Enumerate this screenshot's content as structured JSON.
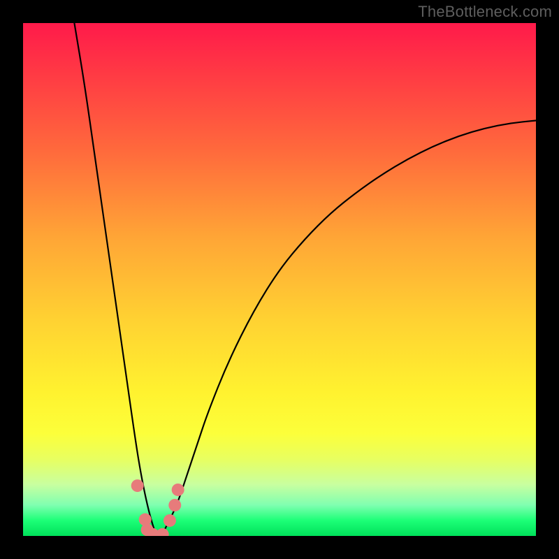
{
  "attribution": "TheBottleneck.com",
  "chart_data": {
    "type": "line",
    "title": "",
    "xlabel": "",
    "ylabel": "",
    "xlim": [
      0,
      100
    ],
    "ylim": [
      0,
      100
    ],
    "series": [
      {
        "name": "bottleneck-curve",
        "x": [
          10,
          12,
          14,
          16,
          18,
          20,
          22,
          23,
          24,
          25,
          26,
          27,
          28,
          30,
          32,
          34,
          36,
          40,
          45,
          50,
          55,
          60,
          65,
          70,
          75,
          80,
          85,
          90,
          95,
          100
        ],
        "values": [
          100,
          88,
          74,
          60,
          46,
          32,
          18,
          12,
          7,
          3,
          0,
          0,
          2,
          6,
          12,
          18,
          24,
          34,
          44,
          52,
          58,
          63,
          67,
          70.5,
          73.5,
          76,
          78,
          79.5,
          80.5,
          81
        ]
      }
    ],
    "points": [
      {
        "x": 22.3,
        "y": 9.8
      },
      {
        "x": 23.8,
        "y": 3.2
      },
      {
        "x": 24.2,
        "y": 1.2
      },
      {
        "x": 25.3,
        "y": 0.3
      },
      {
        "x": 27.2,
        "y": 0.3
      },
      {
        "x": 28.6,
        "y": 3.0
      },
      {
        "x": 29.6,
        "y": 6.0
      },
      {
        "x": 30.2,
        "y": 9.0
      }
    ],
    "point_color": "#e77b7b",
    "annotations": []
  }
}
